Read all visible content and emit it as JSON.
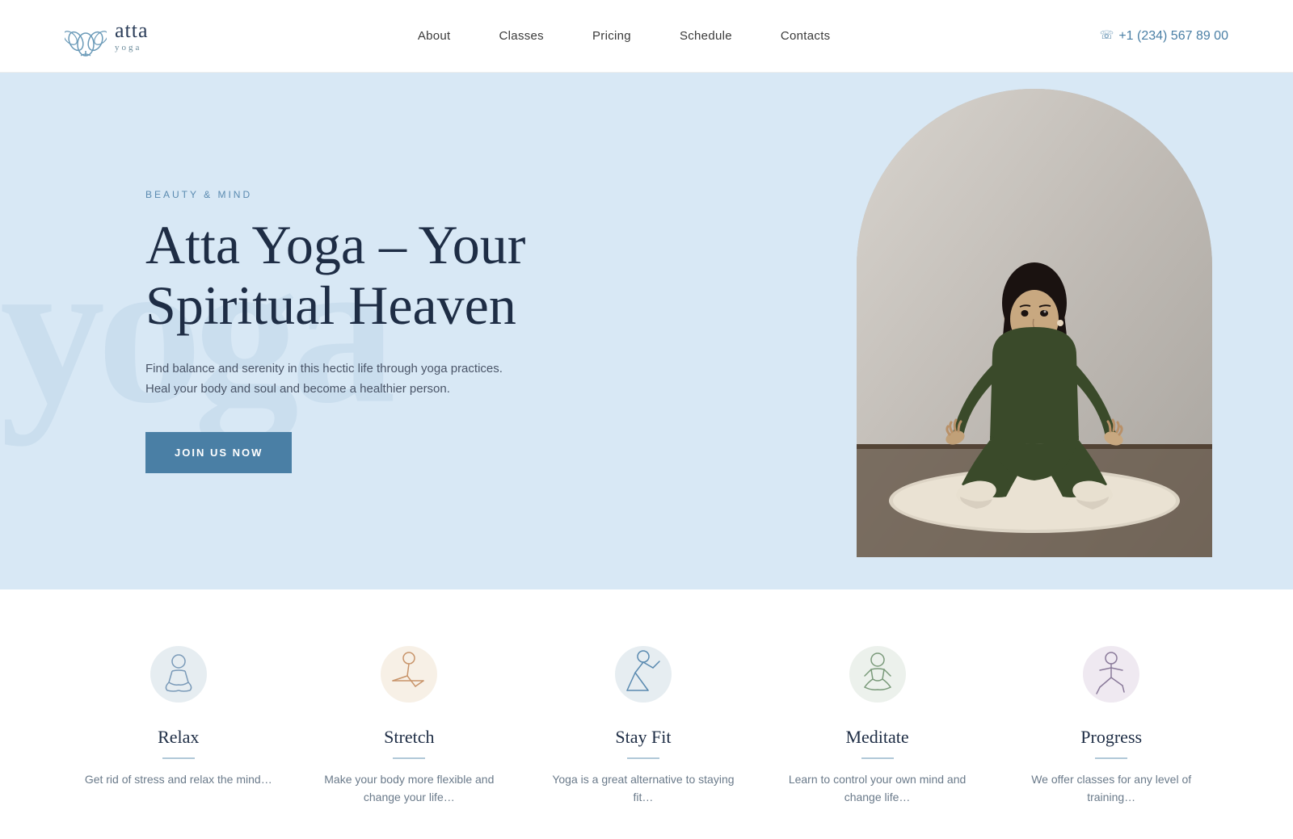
{
  "header": {
    "logo_name": "atta",
    "logo_sub": "yoga",
    "nav": [
      {
        "label": "About",
        "href": "#"
      },
      {
        "label": "Classes",
        "href": "#"
      },
      {
        "label": "Pricing",
        "href": "#"
      },
      {
        "label": "Schedule",
        "href": "#"
      },
      {
        "label": "Contacts",
        "href": "#"
      }
    ],
    "phone_display": "+1 (234) 567 89 00",
    "phone_href": "tel:+12345678900"
  },
  "hero": {
    "tag": "BEAUTY & MIND",
    "title_line1": "Atta Yoga – Your",
    "title_line2": "Spiritual Heaven",
    "description": "Find balance and serenity in this hectic life through yoga practices. Heal your body and soul and become a healthier person.",
    "cta_label": "JOIN US NOW",
    "bg_text": "yoga"
  },
  "features": [
    {
      "title": "Relax",
      "desc": "Get rid of stress and relax the mind…",
      "icon_color": "#b0c4d8",
      "bg_color": "#c8d8e8"
    },
    {
      "title": "Stretch",
      "desc": "Make your body more flexible and change your life…",
      "icon_color": "#d4b896",
      "bg_color": "#e8d4b8"
    },
    {
      "title": "Stay Fit",
      "desc": "Yoga is a great alternative to staying fit…",
      "icon_color": "#90aac4",
      "bg_color": "#b8ccd8"
    },
    {
      "title": "Meditate",
      "desc": "Learn to control your own mind and change life…",
      "icon_color": "#a8b8a8",
      "bg_color": "#c0d0c0"
    },
    {
      "title": "Progress",
      "desc": "We offer classes for any level of training…",
      "icon_color": "#b8a8c4",
      "bg_color": "#d0c0d8"
    }
  ]
}
